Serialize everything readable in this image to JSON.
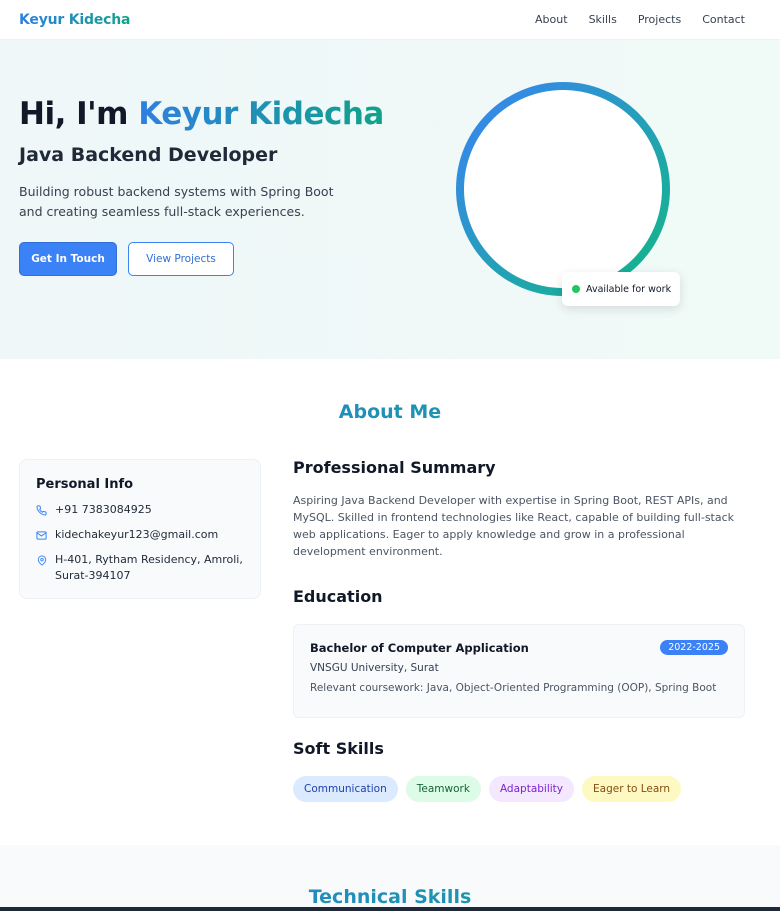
{
  "nav": {
    "brand": "Keyur Kidecha",
    "links": [
      "About",
      "Skills",
      "Projects",
      "Contact"
    ]
  },
  "hero": {
    "greeting": "Hi, I'm ",
    "name": "Keyur Kidecha",
    "role": "Java Backend Developer",
    "tagline": "Building robust backend systems with Spring Boot and creating seamless full-stack experiences.",
    "primary_button": "Get In Touch",
    "secondary_button": "View Projects",
    "status_badge": "Available for work"
  },
  "about": {
    "title": "About Me",
    "personal_info": {
      "heading": "Personal Info",
      "phone": "+91 7383084925",
      "email": "kidechakeyur123@gmail.com",
      "address": "H-401, Rytham Residency, Amroli,\nSurat-394107"
    },
    "summary": {
      "heading": "Professional Summary",
      "text": "Aspiring Java Backend Developer with expertise in Spring Boot, REST APIs, and MySQL. Skilled in frontend technologies like React, capable of building full-stack web applications. Eager to apply knowledge and grow in a professional development environment."
    },
    "education": {
      "heading": "Education",
      "degree": "Bachelor of Computer Application",
      "years": "2022-2025",
      "university": "VNSGU University, Surat",
      "coursework": "Relevant coursework: Java, Object-Oriented Programming (OOP), Spring Boot"
    },
    "soft_skills": {
      "heading": "Soft Skills",
      "items": [
        "Communication",
        "Teamwork",
        "Adaptability",
        "Eager to Learn"
      ]
    }
  },
  "tech": {
    "title": "Technical Skills"
  },
  "colors": {
    "accent_blue": "#3b82f6",
    "accent_green": "#10b981",
    "status_green": "#22c55e"
  }
}
